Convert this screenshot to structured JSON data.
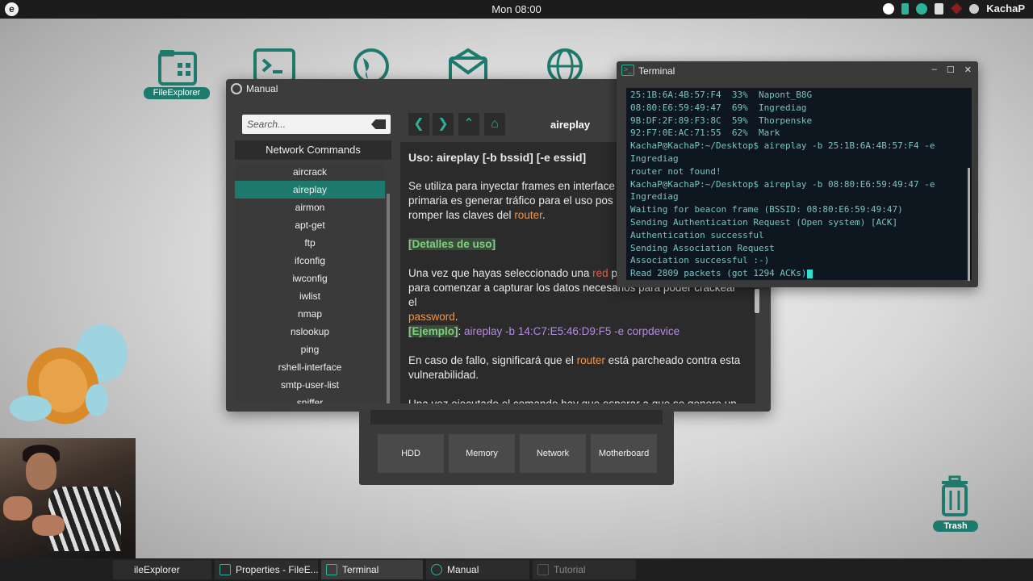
{
  "topbar": {
    "clock": "Mon 08:00",
    "user": "KachaP"
  },
  "desktop": {
    "file_explorer_label": "FileExplorer",
    "trash_label": "Trash"
  },
  "manual": {
    "title": "Manual",
    "search_placeholder": "Search...",
    "nav_header": "Network Commands",
    "nav_items": [
      "aircrack",
      "aireplay",
      "airmon",
      "apt-get",
      "ftp",
      "ifconfig",
      "iwconfig",
      "iwlist",
      "nmap",
      "nslookup",
      "ping",
      "rshell-interface",
      "smtp-user-list",
      "sniffer"
    ],
    "active_item": "aireplay",
    "page_title": "aireplay",
    "content": {
      "usage_heading": "Uso: aireplay [-b bssid] [-e essid]",
      "p1_a": "Se utiliza para inyectar frames en interface",
      "p1_b": "primaria es generar tráfico para el uso pos",
      "p1_c": "romper las claves del ",
      "p1_router": "router",
      "p1_end": ".",
      "details_heading": "[Detalles de uso]",
      "p2_a": "Una vez que hayas seleccionado una ",
      "p2_red": "red",
      "p2_b": " p",
      "p2_c": "para comenzar a capturar los datos necesarios para poder crackear el",
      "p2_password": "password",
      "p2_end": ".",
      "example_label": "[Ejemplo]",
      "example_colon": ": ",
      "example_cmd": "aireplay -b 14:C7:E5:46:D9:F5 -e corpdevice",
      "p3_a": "En caso de fallo, significará que el ",
      "p3_router": "router",
      "p3_b": " está parcheado contra esta",
      "p3_c": "vulnerabilidad.",
      "p4_a": "Una vez ejecutado el comando hay que esperar a que se genere un"
    }
  },
  "hardware": {
    "buttons": [
      "HDD",
      "Memory",
      "Network",
      "Motherboard"
    ]
  },
  "terminal": {
    "title": "Terminal",
    "lines": [
      "25:1B:6A:4B:57:F4  33%  Napont_B8G",
      "08:80:E6:59:49:47  69%  Ingrediag",
      "9B:DF:2F:89:F3:8C  59%  Thorpenske",
      "92:F7:0E:AC:71:55  62%  Mark",
      "KachaP@KachaP:~/Desktop$ aireplay -b 25:1B:6A:4B:57:F4 -e",
      "Ingrediag",
      "router not found!",
      "KachaP@KachaP:~/Desktop$ aireplay -b 08:80:E6:59:49:47 -e",
      "Ingrediag",
      "Waiting for beacon frame (BSSID: 08:80:E6:59:49:47)",
      "Sending Authentication Request (Open system) [ACK]",
      "Authentication successful",
      "Sending Association Request",
      "Association successful :-)",
      "Read 2809 packets (got 1294 ACKs)"
    ]
  },
  "taskbar": {
    "items": [
      "ileExplorer",
      "Properties - FileE...",
      "Terminal",
      "Manual",
      "Tutorial"
    ]
  },
  "colors": {
    "accent": "#1d7a6c",
    "accent_light": "#2bb39a",
    "terminal_text": "#7ac3c0",
    "terminal_bg": "#0e1620"
  }
}
